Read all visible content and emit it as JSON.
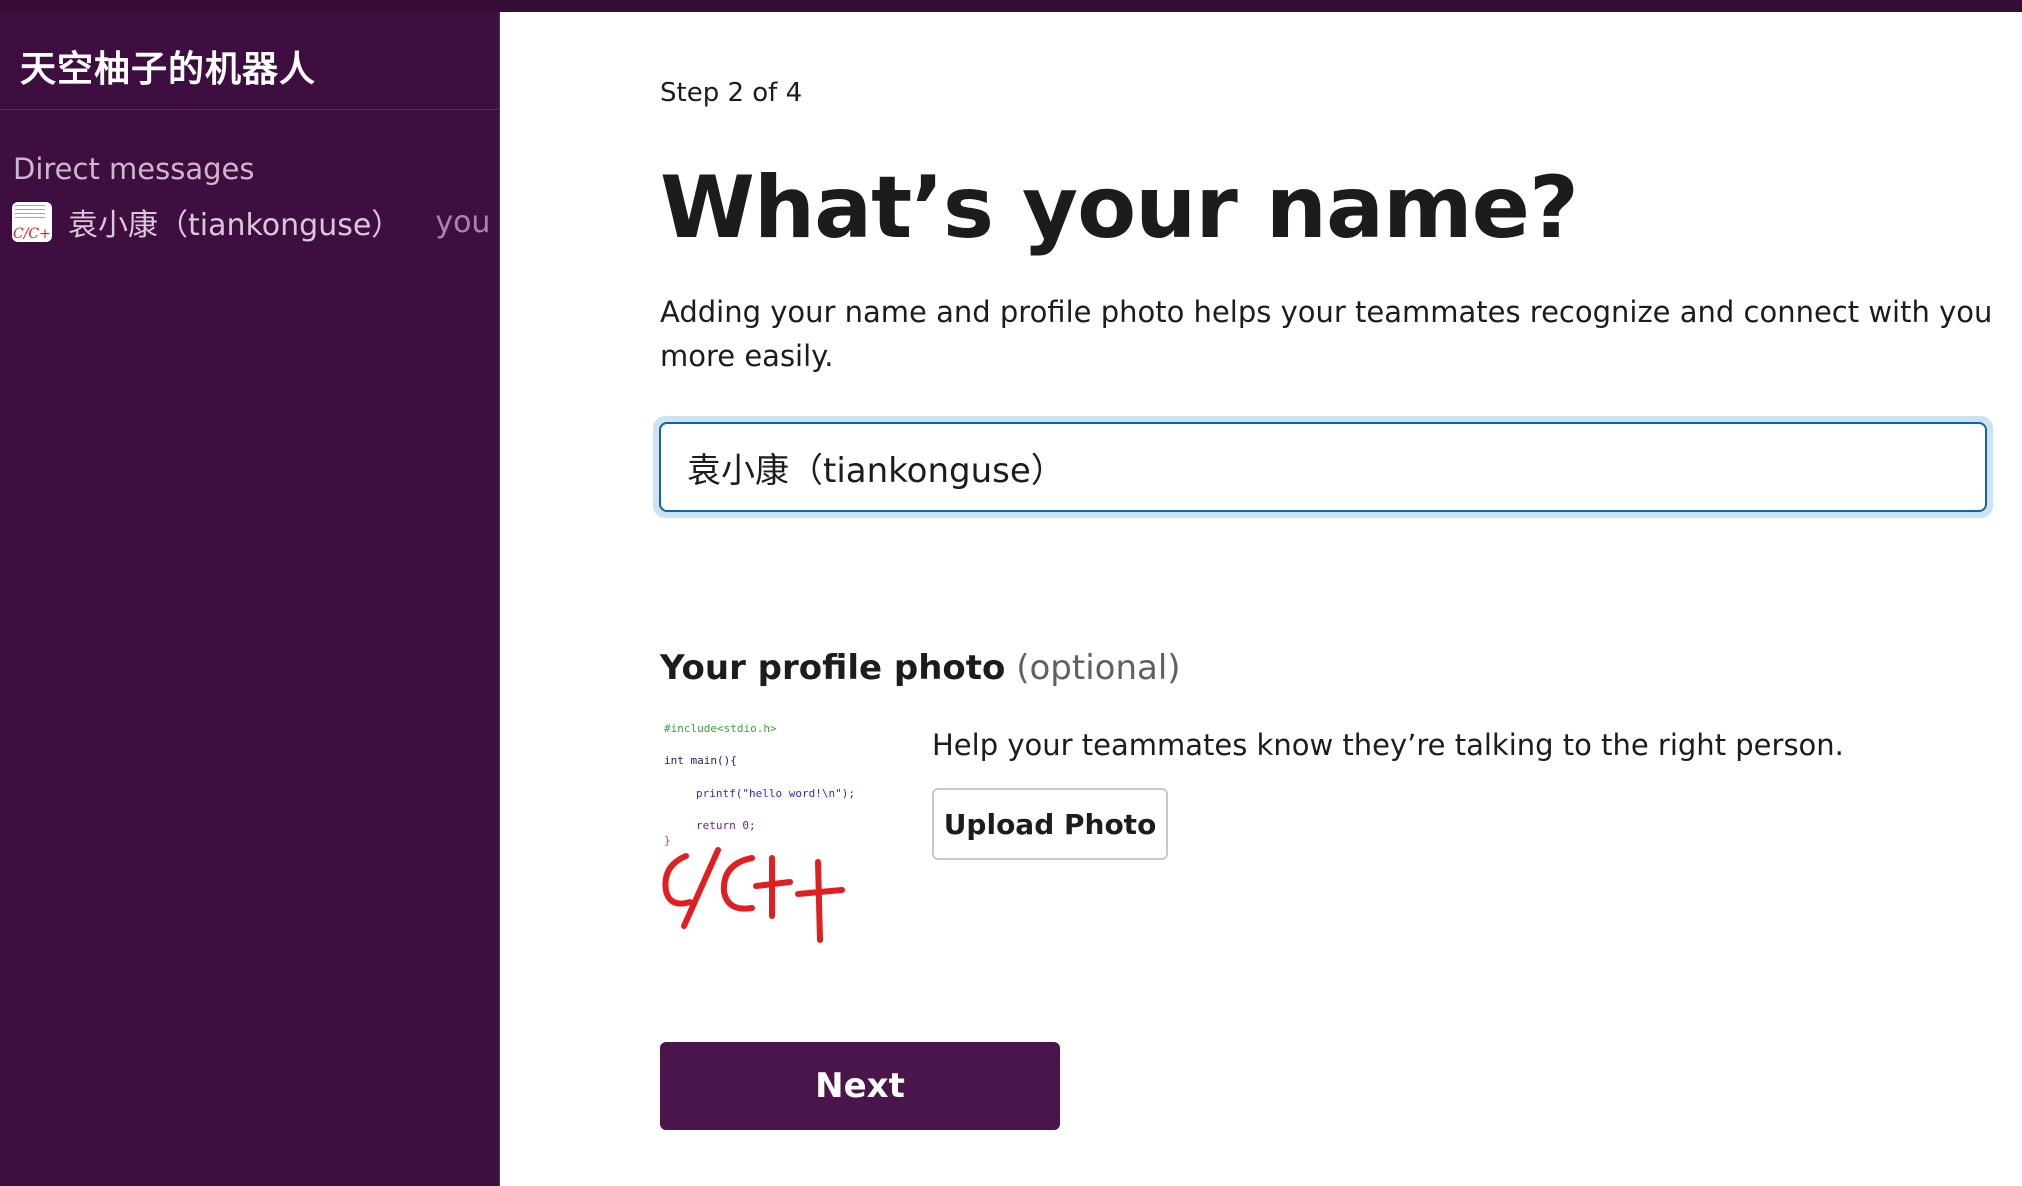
{
  "sidebar": {
    "workspace_name": "天空柚子的机器人",
    "section_title": "Direct messages",
    "dm": {
      "name": "袁小康（tiankonguse）",
      "you_label": "you",
      "avatar_icon": "cpp-code-avatar-icon"
    }
  },
  "main": {
    "step_label": "Step 2 of 4",
    "title": "What’s your name?",
    "subtitle": "Adding your name and profile photo helps your teammates recognize and connect with you more easily.",
    "name_input": {
      "value": "袁小康（tiankonguse）"
    },
    "photo_section": {
      "heading": "Your profile photo",
      "optional_label": "(optional)",
      "help_text": "Help your teammates know they’re talking to the right person.",
      "upload_button_label": "Upload Photo",
      "photo": {
        "code_lines": [
          "#include<stdio.h>",
          "int main(){",
          "printf(\"hello word!\\n\");",
          "return 0;",
          "}"
        ],
        "handwritten_text": "C/C++"
      }
    },
    "next_button_label": "Next"
  },
  "colors": {
    "sidebar_bg": "#3f0e40",
    "topbar_bg": "#350d36",
    "primary_button": "#4a154b",
    "input_focus_border": "#1264a3",
    "input_focus_ring": "#cde3f4",
    "handwriting_red": "#e02020"
  }
}
